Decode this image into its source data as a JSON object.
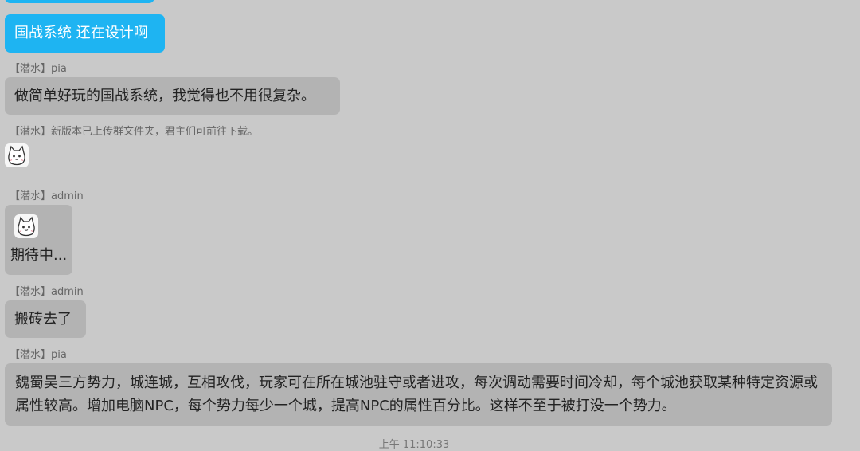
{
  "messages": [
    {
      "text": "国战系统 还在设计啊"
    },
    {
      "sender": "【潜水】pia",
      "text": "做简单好玩的国战系统，我觉得也不用很复杂。"
    },
    {
      "sender": "【潜水】新版本已上传群文件夹，君主们可前往下载。",
      "sticker": "cat-sticker-icon"
    },
    {
      "sender": "【潜水】admin",
      "sticker": "cat-sticker-icon",
      "text": "期待中..."
    },
    {
      "sender": "【潜水】admin",
      "text": "搬砖去了"
    },
    {
      "sender": "【潜水】pia",
      "text": "魏蜀吴三方势力，城连城，互相攻伐，玩家可在所在城池驻守或者进攻，每次调动需要时间冷却，每个城池获取某种特定资源或属性较高。增加电脑NPC，每个势力每少一个城，提高NPC的属性百分比。这样不至于被打没一个势力。"
    }
  ],
  "timestamp": "上午 11:10:33",
  "colors": {
    "background": "#c9c9c9",
    "bubble_gray": "#b3b3b3",
    "bubble_blue": "#1eb4f2"
  }
}
